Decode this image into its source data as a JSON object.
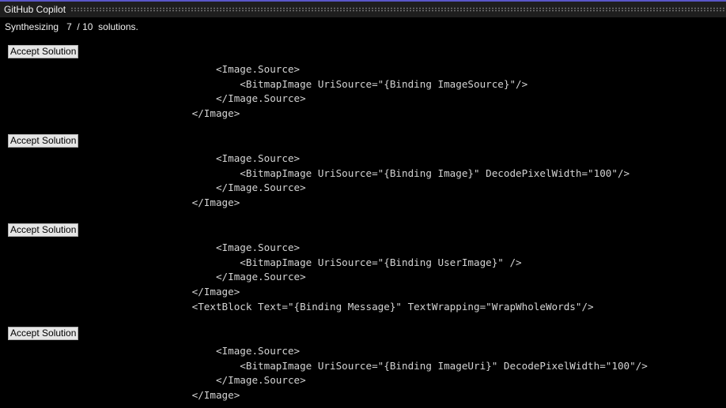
{
  "title": "GitHub Copilot",
  "status": {
    "prefix": "Synthesizing",
    "current": "7",
    "separator": "/",
    "total": "10",
    "suffix": "solutions."
  },
  "accept_label": "Accept Solution",
  "colors": {
    "accent": "#5a56c8",
    "background": "#000000",
    "text": "#f1f1f1",
    "code": "#d4d4d4"
  },
  "solutions": [
    {
      "lines": [
        "                                    <Image.Source>",
        "                                        <BitmapImage UriSource=\"{Binding ImageSource}\"/>",
        "                                    </Image.Source>",
        "                                </Image>"
      ]
    },
    {
      "lines": [
        "                                    <Image.Source>",
        "                                        <BitmapImage UriSource=\"{Binding Image}\" DecodePixelWidth=\"100\"/>",
        "                                    </Image.Source>",
        "                                </Image>"
      ]
    },
    {
      "lines": [
        "                                    <Image.Source>",
        "                                        <BitmapImage UriSource=\"{Binding UserImage}\" />",
        "                                    </Image.Source>",
        "                                </Image>",
        "                                <TextBlock Text=\"{Binding Message}\" TextWrapping=\"WrapWholeWords\"/>"
      ]
    },
    {
      "lines": [
        "                                    <Image.Source>",
        "                                        <BitmapImage UriSource=\"{Binding ImageUri}\" DecodePixelWidth=\"100\"/>",
        "                                    </Image.Source>",
        "                                </Image>"
      ]
    }
  ]
}
